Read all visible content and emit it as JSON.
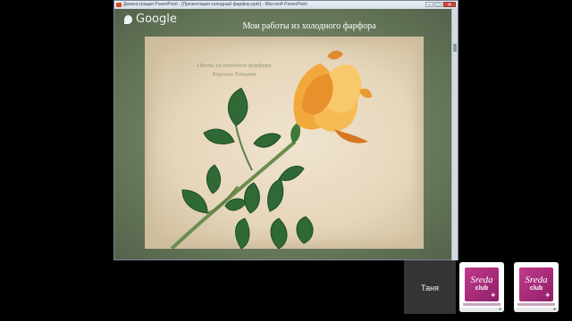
{
  "window": {
    "title": "Демонстрация PowerPoint - [Презентация холодный фарфор.pptx] - Microsoft PowerPoint",
    "controls": {
      "minimize": "–",
      "maximize": "□",
      "close": "✕"
    }
  },
  "overlay": {
    "brand": "Google"
  },
  "slide": {
    "title": "Мои работы из холодного фарфора",
    "signature_line1": "Цветы из холодного фарфора",
    "signature_line2": "Карлина Татьяна"
  },
  "participants": {
    "active_name": "Таня",
    "thumbs": [
      {
        "brand_top": "Sreda",
        "brand_bottom": "club"
      },
      {
        "brand_top": "Sreda",
        "brand_bottom": "club"
      }
    ]
  },
  "colors": {
    "slide_frame": "#6a7b5c",
    "photo_bg": "#ead9bd",
    "rose_petal": "#f2a93b",
    "leaf": "#2f6a36",
    "brand_magenta": "#b8307f"
  }
}
